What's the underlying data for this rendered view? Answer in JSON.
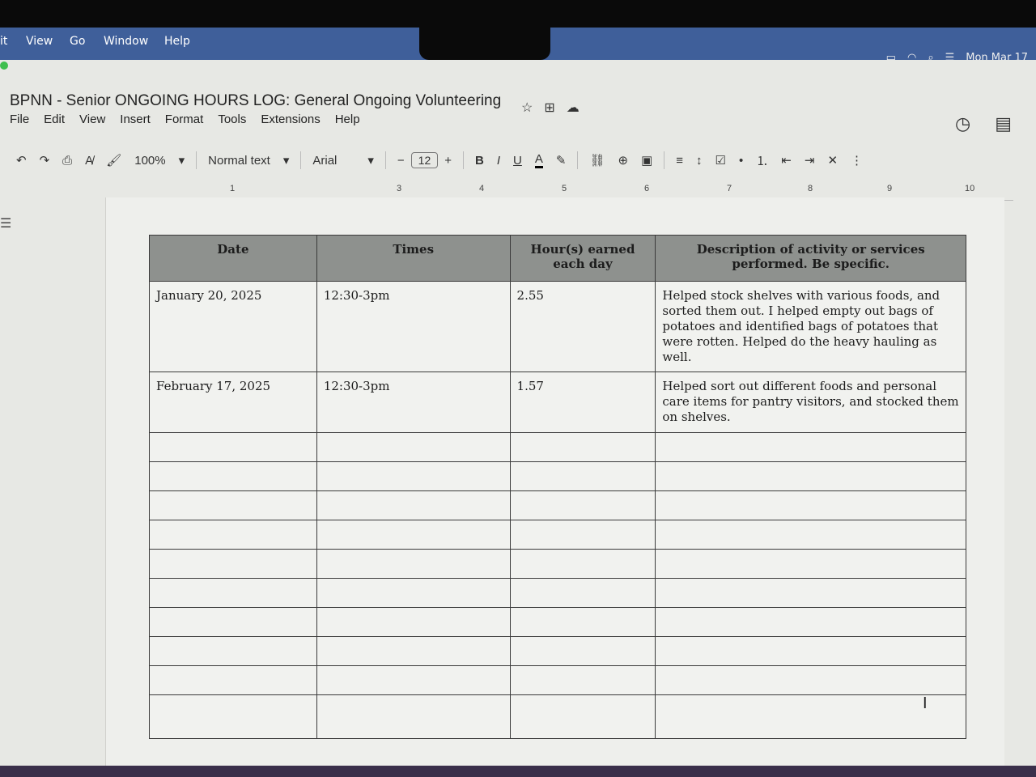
{
  "mac_menubar": {
    "items": [
      "it",
      "View",
      "Go",
      "Window",
      "Help"
    ],
    "clock": "Mon Mar 17"
  },
  "document": {
    "title": "BPNN - Senior ONGOING HOURS LOG: General Ongoing Volunteering",
    "menu": [
      "File",
      "Edit",
      "View",
      "Insert",
      "Format",
      "Tools",
      "Extensions",
      "Help"
    ]
  },
  "toolbar": {
    "zoom": "100%",
    "style": "Normal text",
    "font": "Arial",
    "font_size": "12",
    "bold": "B",
    "italic": "I",
    "underline": "U",
    "text_color": "A"
  },
  "ruler": {
    "ticks": [
      "1",
      "3",
      "4",
      "5",
      "6",
      "7",
      "8",
      "9",
      "10"
    ]
  },
  "table": {
    "headers": [
      "Date",
      "Times",
      "Hour(s) earned each day",
      "Description of activity or services performed. Be specific."
    ],
    "rows": [
      [
        "January 20, 2025",
        "12:30-3pm",
        "2.55",
        "Helped stock shelves with various foods, and sorted them out. I helped empty out bags of potatoes and identified bags of potatoes that were rotten. Helped do the heavy hauling as well."
      ],
      [
        "February 17, 2025",
        "12:30-3pm",
        "1.57",
        "Helped sort out different foods and personal care items for pantry visitors, and stocked them on shelves."
      ]
    ],
    "empty_rows": 10
  }
}
